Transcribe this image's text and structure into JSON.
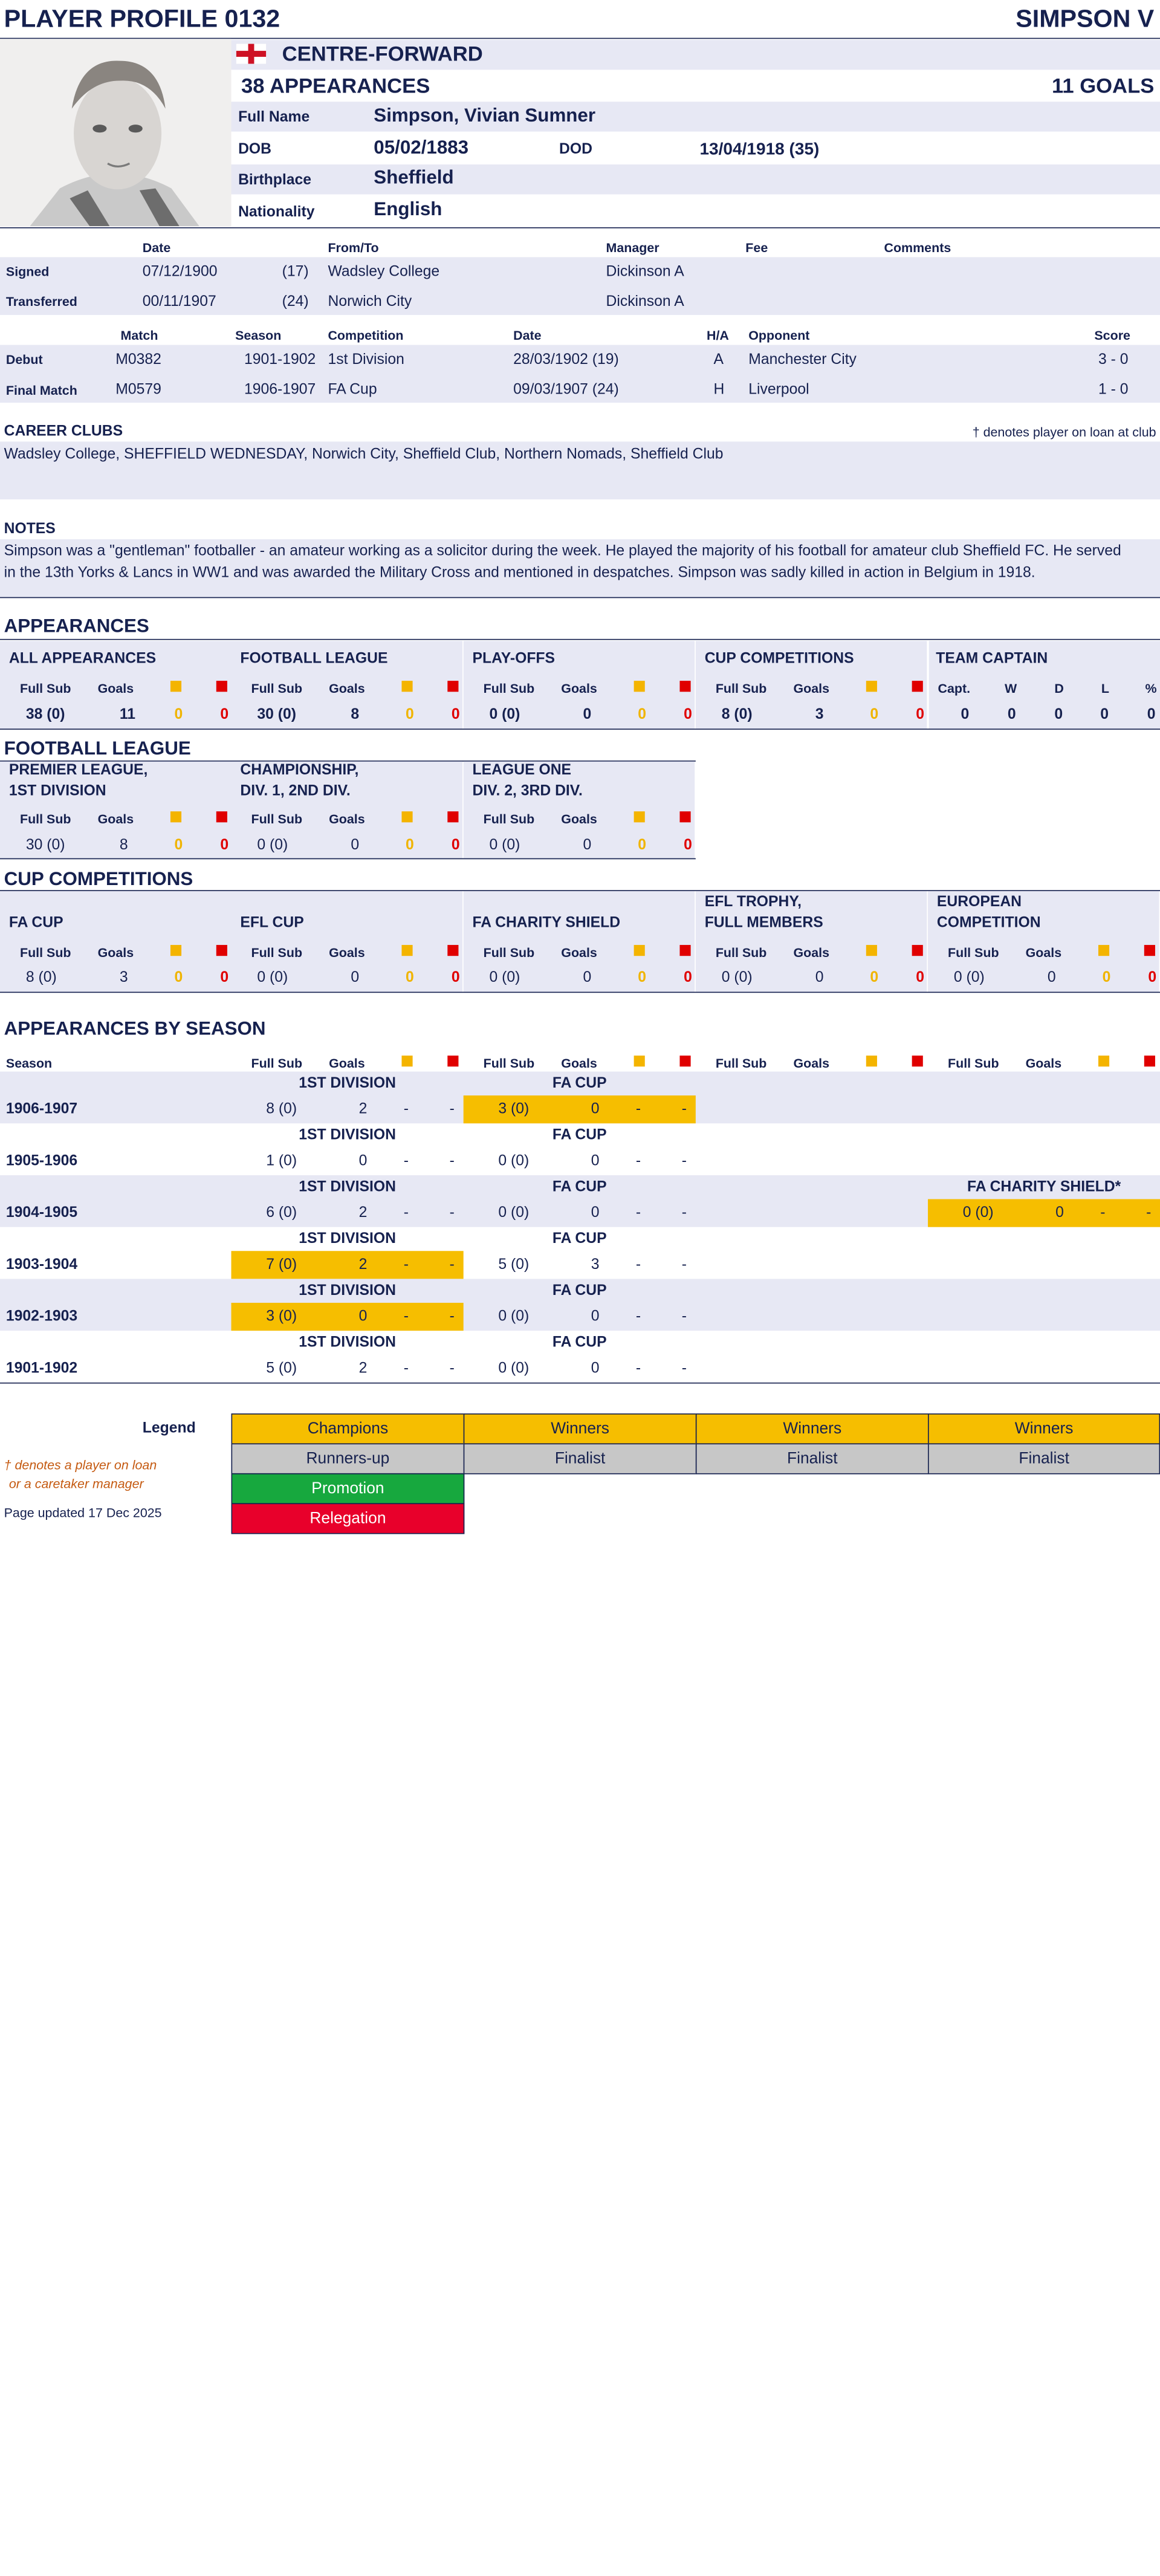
{
  "header": {
    "title": "PLAYER PROFILE 0132",
    "name": "SIMPSON V"
  },
  "profile": {
    "position": "CENTRE-FORWARD",
    "appearances": "38 APPEARANCES",
    "goals": "11 GOALS",
    "full_name_label": "Full Name",
    "full_name": "Simpson, Vivian Sumner",
    "dob_label": "DOB",
    "dob": "05/02/1883",
    "dod_label": "DOD",
    "dod": "13/04/1918 (35)",
    "birthplace_label": "Birthplace",
    "birthplace": "Sheffield",
    "nationality_label": "Nationality",
    "nationality": "English"
  },
  "transfers": {
    "headers": {
      "date": "Date",
      "from_to": "From/To",
      "manager": "Manager",
      "fee": "Fee",
      "comments": "Comments"
    },
    "rows": [
      {
        "label": "Signed",
        "date": "07/12/1900",
        "age": "(17)",
        "club": "Wadsley College",
        "manager": "Dickinson A"
      },
      {
        "label": "Transferred",
        "date": "00/11/1907",
        "age": "(24)",
        "club": "Norwich City",
        "manager": "Dickinson A"
      }
    ]
  },
  "matches": {
    "headers": {
      "match": "Match",
      "season": "Season",
      "competition": "Competition",
      "date": "Date",
      "ha": "H/A",
      "opponent": "Opponent",
      "score": "Score"
    },
    "rows": [
      {
        "label": "Debut",
        "match": "M0382",
        "season": "1901-1902",
        "competition": "1st Division",
        "date": "28/03/1902 (19)",
        "ha": "A",
        "opponent": "Manchester City",
        "score": "3 - 0"
      },
      {
        "label": "Final Match",
        "match": "M0579",
        "season": "1906-1907",
        "competition": "FA Cup",
        "date": "09/03/1907 (24)",
        "ha": "H",
        "opponent": "Liverpool",
        "score": "1 - 0"
      }
    ]
  },
  "career": {
    "title": "CAREER CLUBS",
    "loan_note": "† denotes player on loan at club",
    "clubs": "Wadsley College, SHEFFIELD WEDNESDAY, Norwich City, Sheffield Club, Northern Nomads, Sheffield Club"
  },
  "notes": {
    "title": "NOTES",
    "line1": "Simpson was a \"gentleman\" footballer - an amateur working as a solicitor during the week.  He played the majority of his football for amateur club Sheffield FC.  He served",
    "line2": "in the 13th Yorks & Lancs in WW1 and was awarded the Military Cross and mentioned in despatches.  Simpson was sadly killed in action in Belgium in 1918."
  },
  "col_labels": {
    "full_sub": "Full Sub",
    "goals": "Goals",
    "capt": "Capt.",
    "w": "W",
    "d": "D",
    "l": "L",
    "pct": "%"
  },
  "appearances": {
    "title": "APPEARANCES",
    "boxes": [
      {
        "title": "ALL APPEARANCES",
        "fs": "38 (0)",
        "g": "11",
        "y": "0",
        "r": "0"
      },
      {
        "title": "FOOTBALL LEAGUE",
        "fs": "30 (0)",
        "g": "8",
        "y": "0",
        "r": "0"
      },
      {
        "title": "PLAY-OFFS",
        "fs": "0 (0)",
        "g": "0",
        "y": "0",
        "r": "0"
      },
      {
        "title": "CUP COMPETITIONS",
        "fs": "8 (0)",
        "g": "3",
        "y": "0",
        "r": "0"
      }
    ],
    "captain": {
      "title": "TEAM CAPTAIN",
      "capt": "0",
      "w": "0",
      "d": "0",
      "l": "0",
      "pct": "0"
    }
  },
  "football_league": {
    "title": "FOOTBALL LEAGUE",
    "boxes": [
      {
        "t1": "PREMIER LEAGUE,",
        "t2": "1ST DIVISION",
        "fs": "30 (0)",
        "g": "8",
        "y": "0",
        "r": "0"
      },
      {
        "t1": "CHAMPIONSHIP,",
        "t2": "DIV. 1, 2ND DIV.",
        "fs": "0 (0)",
        "g": "0",
        "y": "0",
        "r": "0"
      },
      {
        "t1": "LEAGUE ONE",
        "t2": "DIV. 2, 3RD DIV.",
        "fs": "0 (0)",
        "g": "0",
        "y": "0",
        "r": "0"
      }
    ]
  },
  "cup_competitions": {
    "title": "CUP COMPETITIONS",
    "boxes": [
      {
        "t1": "",
        "t2": "FA CUP",
        "fs": "8 (0)",
        "g": "3",
        "y": "0",
        "r": "0"
      },
      {
        "t1": "",
        "t2": "EFL CUP",
        "fs": "0 (0)",
        "g": "0",
        "y": "0",
        "r": "0"
      },
      {
        "t1": "",
        "t2": "FA CHARITY SHIELD",
        "fs": "0 (0)",
        "g": "0",
        "y": "0",
        "r": "0"
      },
      {
        "t1": "EFL TROPHY,",
        "t2": "FULL MEMBERS",
        "fs": "0 (0)",
        "g": "0",
        "y": "0",
        "r": "0"
      },
      {
        "t1": "EUROPEAN",
        "t2": "COMPETITION",
        "fs": "0 (0)",
        "g": "0",
        "y": "0",
        "r": "0"
      }
    ]
  },
  "by_season": {
    "title": "APPEARANCES BY SEASON",
    "season_label": "Season",
    "rows": [
      {
        "season": "1906-1907",
        "c1": {
          "comp": "1ST DIVISION",
          "fs": "8 (0)",
          "g": "2",
          "y": "-",
          "r": "-",
          "hl": false
        },
        "c2": {
          "comp": "FA CUP",
          "fs": "3 (0)",
          "g": "0",
          "y": "-",
          "r": "-",
          "hl": true
        }
      },
      {
        "season": "1905-1906",
        "c1": {
          "comp": "1ST DIVISION",
          "fs": "1 (0)",
          "g": "0",
          "y": "-",
          "r": "-",
          "hl": false
        },
        "c2": {
          "comp": "FA CUP",
          "fs": "0 (0)",
          "g": "0",
          "y": "-",
          "r": "-",
          "hl": false
        }
      },
      {
        "season": "1904-1905",
        "c1": {
          "comp": "1ST DIVISION",
          "fs": "6 (0)",
          "g": "2",
          "y": "-",
          "r": "-",
          "hl": false
        },
        "c2": {
          "comp": "FA CUP",
          "fs": "0 (0)",
          "g": "0",
          "y": "-",
          "r": "-",
          "hl": false
        },
        "c4": {
          "comp": "FA CHARITY SHIELD*",
          "fs": "0 (0)",
          "g": "0",
          "y": "-",
          "r": "-",
          "hl": true
        }
      },
      {
        "season": "1903-1904",
        "c1": {
          "comp": "1ST DIVISION",
          "fs": "7 (0)",
          "g": "2",
          "y": "-",
          "r": "-",
          "hl": true
        },
        "c2": {
          "comp": "FA CUP",
          "fs": "5 (0)",
          "g": "3",
          "y": "-",
          "r": "-",
          "hl": false
        }
      },
      {
        "season": "1902-1903",
        "c1": {
          "comp": "1ST DIVISION",
          "fs": "3 (0)",
          "g": "0",
          "y": "-",
          "r": "-",
          "hl": true
        },
        "c2": {
          "comp": "FA CUP",
          "fs": "0 (0)",
          "g": "0",
          "y": "-",
          "r": "-",
          "hl": false
        }
      },
      {
        "season": "1901-1902",
        "c1": {
          "comp": "1ST DIVISION",
          "fs": "5 (0)",
          "g": "2",
          "y": "-",
          "r": "-",
          "hl": false
        },
        "c2": {
          "comp": "FA CUP",
          "fs": "0 (0)",
          "g": "0",
          "y": "-",
          "r": "-",
          "hl": false
        }
      }
    ]
  },
  "legend": {
    "title": "Legend",
    "loan_note1": "† denotes a player on loan",
    "loan_note2": "or a caretaker manager",
    "updated": "Page updated 17 Dec 2025",
    "champions": "Champions",
    "runners_up": "Runners-up",
    "promotion": "Promotion",
    "relegation": "Relegation",
    "winners": "Winners",
    "finalist": "Finalist",
    "colors": {
      "gold": "#f6be00",
      "grey": "#c7c7c7",
      "green": "#17a83e",
      "red": "#e8002b"
    }
  }
}
